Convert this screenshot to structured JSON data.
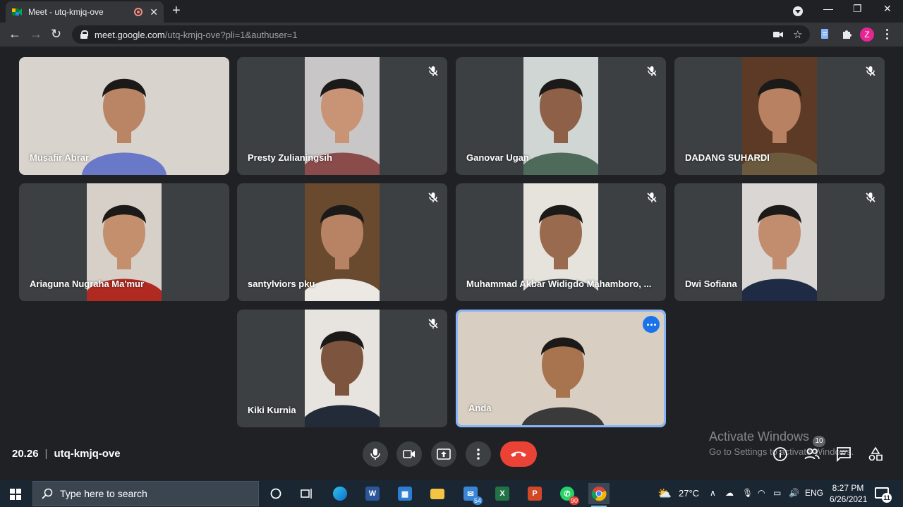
{
  "browser": {
    "tab_title": "Meet - utq-kmjq-ove",
    "tab_close": "✕",
    "new_tab": "+",
    "url_host": "meet.google.com",
    "url_path": "/utq-kmjq-ove?pli=1&authuser=1",
    "profile_initial": "Z",
    "window_minimize": "—",
    "window_restore": "❐",
    "window_close": "✕"
  },
  "participants": [
    {
      "name": "Musafir Abrar",
      "muted": false,
      "bg": "#d8d3cc",
      "shirt": "#6a78c8",
      "skin": "#b98565"
    },
    {
      "name": "Presty Zulianingsih",
      "muted": true,
      "bg": "#c9c6c8",
      "shirt": "#8a4b4b",
      "skin": "#c99376"
    },
    {
      "name": "Ganovar Ugan",
      "muted": true,
      "bg": "#cfd6d4",
      "shirt": "#4e6a5a",
      "skin": "#8e6048"
    },
    {
      "name": "DADANG SUHARDI",
      "muted": true,
      "bg": "#5c3a26",
      "shirt": "#6b5a3e",
      "skin": "#b78162"
    },
    {
      "name": "Ariaguna Nugraha Ma'mur",
      "muted": false,
      "bg": "#d6d0c8",
      "shirt": "#b02a22",
      "skin": "#c48f6d"
    },
    {
      "name": "santylviors pku",
      "muted": true,
      "bg": "#6a4a2e",
      "shirt": "#ece9e4",
      "skin": "#b78364"
    },
    {
      "name": "Muhammad Akbar Widigdo Mahamboro, ...",
      "muted": true,
      "bg": "#e6e2dc",
      "shirt": "#3c3f44",
      "skin": "#9a6a4f"
    },
    {
      "name": "Dwi Sofiana",
      "muted": true,
      "bg": "#d9d6d3",
      "shirt": "#1f2a44",
      "skin": "#c28d6e"
    },
    {
      "name": "Kiki Kurnia",
      "muted": true,
      "bg": "#e7e4df",
      "shirt": "#232b38",
      "skin": "#7d553e"
    },
    {
      "name": "Anda",
      "muted": false,
      "bg": "#d8cfc2",
      "shirt": "#3a3a3a",
      "skin": "#a8734f"
    }
  ],
  "meeting": {
    "time": "20.26",
    "separator": "|",
    "code": "utq-kmjq-ove",
    "participant_count": "10"
  },
  "watermark": {
    "line1": "Activate Windows",
    "line2": "Go to Settings to activate Windows."
  },
  "taskbar": {
    "search_placeholder": "Type here to search",
    "weather": "27°C",
    "language": "ENG",
    "time": "8:27 PM",
    "date": "6/26/2021",
    "mail_badge": "54",
    "whatsapp_badge": "90",
    "notification_count": "11"
  },
  "colors": {
    "meet_bg": "#202124",
    "tile_bg": "#3c4043",
    "end_call": "#ea4335",
    "self_border": "#8ab4f8",
    "accent": "#1a73e8"
  }
}
